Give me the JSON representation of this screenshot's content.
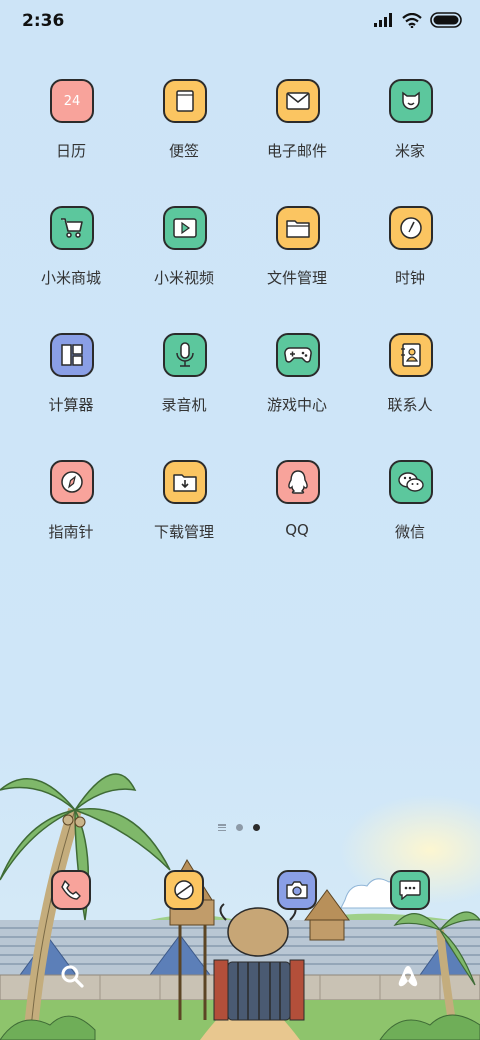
{
  "status_bar": {
    "time": "2:36",
    "icons": [
      "signal-icon",
      "wifi-icon",
      "battery-icon"
    ]
  },
  "apps": [
    {
      "label": "日历",
      "icon": "calendar-icon",
      "color": "#f8a39b",
      "badge": "24"
    },
    {
      "label": "便签",
      "icon": "notes-icon",
      "color": "#fbc561"
    },
    {
      "label": "电子邮件",
      "icon": "mail-icon",
      "color": "#fbc561"
    },
    {
      "label": "米家",
      "icon": "mijia-icon",
      "color": "#5cc79d"
    },
    {
      "label": "小米商城",
      "icon": "shopping-cart-icon",
      "color": "#5cc79d"
    },
    {
      "label": "小米视频",
      "icon": "video-play-icon",
      "color": "#5cc79d"
    },
    {
      "label": "文件管理",
      "icon": "folder-icon",
      "color": "#fbc561"
    },
    {
      "label": "时钟",
      "icon": "clock-icon",
      "color": "#fbc561"
    },
    {
      "label": "计算器",
      "icon": "calculator-icon",
      "color": "#8a9fe6"
    },
    {
      "label": "录音机",
      "icon": "microphone-icon",
      "color": "#5cc79d"
    },
    {
      "label": "游戏中心",
      "icon": "gamepad-icon",
      "color": "#5cc79d"
    },
    {
      "label": "联系人",
      "icon": "contacts-icon",
      "color": "#fbc561"
    },
    {
      "label": "指南针",
      "icon": "compass-icon",
      "color": "#f8a39b"
    },
    {
      "label": "下载管理",
      "icon": "download-folder-icon",
      "color": "#fbc561"
    },
    {
      "label": "QQ",
      "icon": "qq-icon",
      "color": "#f8a39b"
    },
    {
      "label": "微信",
      "icon": "wechat-icon",
      "color": "#5cc79d"
    }
  ],
  "page_indicator": {
    "pages": 3,
    "current": 3
  },
  "dock": [
    {
      "icon": "phone-icon",
      "color": "#f8a39b"
    },
    {
      "icon": "browser-icon",
      "color": "#fbc561"
    },
    {
      "icon": "camera-icon",
      "color": "#8a9fe6"
    },
    {
      "icon": "messages-icon",
      "color": "#5cc79d"
    }
  ],
  "bottom_icons": [
    "search-icon",
    "airbnb-icon"
  ]
}
